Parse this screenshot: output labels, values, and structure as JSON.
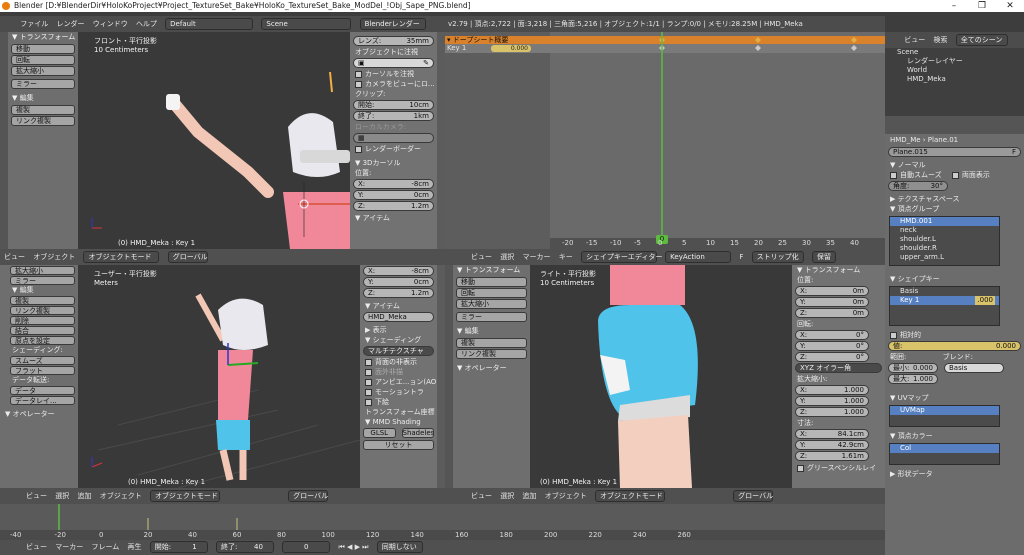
{
  "titlebar": {
    "title": "Blender [D:¥BlenderDir¥HoloKoProject¥Project_TextureSet_Bake¥HoloKo_TextureSet_Bake_ModDel_!Obj_Sape_PNG.blend]"
  },
  "infobar": {
    "menus": [
      "ファイル",
      "レンダー",
      "ウィンドウ",
      "ヘルプ"
    ],
    "layout": "Default",
    "scene": "Scene",
    "engine": "Blenderレンダー",
    "stats": "v2.79 | 頂点:2,722 | 面:3,218 | 三角面:5,216 | オブジェクト:1/1 | ランプ:0/0 | メモリ:28.25M | HMD_Meka"
  },
  "toolshelf_top": {
    "section1": "▼ トランスフォーム",
    "buttons1": [
      "移動",
      "回転",
      "拡大縮小",
      "ミラー"
    ],
    "section2": "▼ 編集",
    "buttons2": [
      "複製",
      "リンク複製"
    ],
    "tabs": [
      "ツール",
      "作成",
      "リレーション",
      "アニメーション",
      "物理演算",
      "グリース",
      "MMD"
    ]
  },
  "viewport_top": {
    "view": "フロント・平行投影",
    "scale": "10 Centimeters",
    "object": "(0) HMD_Meka : Key 1"
  },
  "npanel_top": {
    "lens_label": "レンズ:",
    "lens_value": "35mm",
    "lock_label": "オブジェクトに注視",
    "lock_cursor": "カーソルを注視",
    "lock_camera": "カメラをビューにロ...",
    "clip_label": "クリップ:",
    "clip_start_label": "開始:",
    "clip_start": "10cm",
    "clip_end_label": "終了:",
    "clip_end": "1km",
    "local_camera": "ローカルカメラ:",
    "render_border": "レンダーボーダー",
    "cursor_section": "▼ 3Dカーソル",
    "location_label": "位置:",
    "x_label": "X:",
    "x": "-8cm",
    "y_label": "Y:",
    "y": "0cm",
    "z_label": "Z:",
    "z": "1.2m",
    "item_section": "▼ アイテム"
  },
  "dopesheet": {
    "summary": "ドープシート概要",
    "key_label": "Key 1",
    "key_value": "0.000",
    "ruler": [
      "-20",
      "-15",
      "-10",
      "-5",
      "0",
      "5",
      "10",
      "15",
      "20",
      "25",
      "30",
      "35",
      "40"
    ],
    "current_frame": "0",
    "header": [
      "ビュー",
      "選択",
      "マーカー",
      "キー"
    ],
    "mode": "シェイプキーエディター",
    "action": "KeyAction",
    "action_flag": "F",
    "stash": "ストリップ化",
    "push": "保留"
  },
  "outliner": {
    "header_view": "ビュー",
    "header_search": "検索",
    "filter": "全てのシーン",
    "items": [
      "Scene",
      "レンダーレイヤー",
      "World",
      "HMD_Meka"
    ]
  },
  "properties": {
    "breadcrumb_obj": "HMD_Me",
    "breadcrumb_mesh": "Plane.01",
    "mesh_name": "Plane.015",
    "mesh_flag": "F",
    "normals_section": "▼ ノーマル",
    "auto_smooth": "自動スムーズ",
    "double_sided": "両面表示",
    "angle_label": "角度:",
    "angle": "30°",
    "texspace_section": "▶ テクスチャスペース",
    "vgroups_section": "▼ 頂点グループ",
    "vgroups": [
      "HMD.001",
      "neck",
      "shoulder.L",
      "shoulder.R",
      "upper_arm.L"
    ],
    "shapekeys_section": "▼ シェイプキー",
    "shapekeys": [
      {
        "name": "Basis",
        "value": ""
      },
      {
        "name": "Key 1",
        "value": ".000"
      }
    ],
    "relative": "相対的",
    "value_label": "値:",
    "value": "0.000",
    "range_label": "範囲:",
    "blend_label": "ブレンド:",
    "min_label": "最小:",
    "min": "0.000",
    "max_label": "最大:",
    "max": "1.000",
    "blend_target": "Basis",
    "uv_section": "▼ UVマップ",
    "uvmap": "UVMap",
    "vcol_section": "▼ 頂点カラー",
    "vcol": "Col",
    "shape_data": "▶ 形状データ"
  },
  "viewport_bar_mid": {
    "menus": [
      "ビュー",
      "選択",
      "追加",
      "オブジェクト"
    ],
    "mode": "オブジェクトモード",
    "orient": "グローバル"
  },
  "toolshelf_bottom": {
    "items": [
      "拡大縮小",
      "ミラー",
      "▼ 編集",
      "複製",
      "リンク複製",
      "削除",
      "結合",
      "原点を設定",
      "シェーディング:",
      "スムーズ",
      "フラット",
      "データ転送:",
      "データ",
      "データレイ..."
    ],
    "operator": "▼ オペレーター"
  },
  "viewport_bl": {
    "view": "ユーザー・平行投影",
    "scale": "Meters",
    "object": "(0) HMD_Meka : Key 1"
  },
  "npanel_bottom": {
    "x_label": "X:",
    "x": "-8cm",
    "y_label": "Y:",
    "y": "0cm",
    "z_label": "Z:",
    "z": "1.2m",
    "item_section": "▼ アイテム",
    "item_name": "HMD_Meka",
    "display_section": "▶ 表示",
    "shading_section": "▼ シェーディング",
    "shading_mode": "マルチテクスチャ",
    "backface": "背面の非表示",
    "matcap": "面外非描",
    "ao": "アンビエ...ョン(AO)",
    "motion_tracking": "モーショントラ",
    "background": "下絵",
    "transform_orient": "トランスフォーム座標",
    "mmd_section": "▼ MMD Shading",
    "glsl": "GLSL",
    "shadeless": "Shadeless",
    "reset": "リセット"
  },
  "toolshelf_br": {
    "section1": "▼ トランスフォーム",
    "buttons1": [
      "移動",
      "回転",
      "拡大縮小",
      "ミラー"
    ],
    "section2": "▼ 編集",
    "buttons2": [
      "複製",
      "リンク複製"
    ],
    "operator": "▼ オペレーター"
  },
  "viewport_br": {
    "view": "ライト・平行投影",
    "scale": "10 Centimeters",
    "object": "(0) HMD_Meka : Key 1"
  },
  "transform_panel": {
    "title": "▼ トランスフォーム",
    "location_label": "位置:",
    "loc": [
      {
        "l": "X:",
        "v": "0m"
      },
      {
        "l": "Y:",
        "v": "0m"
      },
      {
        "l": "Z:",
        "v": "0m"
      }
    ],
    "rotation_label": "回転:",
    "rot": [
      {
        "l": "X:",
        "v": "0°"
      },
      {
        "l": "Y:",
        "v": "0°"
      },
      {
        "l": "Z:",
        "v": "0°"
      }
    ],
    "rot_mode": "XYZ オイラー角",
    "scale_label": "拡大縮小:",
    "scl": [
      {
        "l": "X:",
        "v": "1.000"
      },
      {
        "l": "Y:",
        "v": "1.000"
      },
      {
        "l": "Z:",
        "v": "1.000"
      }
    ],
    "dim_label": "寸法:",
    "dim": [
      {
        "l": "X:",
        "v": "84.1cm"
      },
      {
        "l": "Y:",
        "v": "42.9cm"
      },
      {
        "l": "Z:",
        "v": "1.61m"
      }
    ],
    "grease": "グリースペンシルレイ"
  },
  "viewport_bar_bottom": {
    "menus": [
      "ビュー",
      "選択",
      "追加",
      "オブジェクト"
    ],
    "mode": "オブジェクトモード",
    "orient": "グローバル",
    "menus2": [
      "ビュー",
      "選択",
      "追加",
      "オブジェクト"
    ],
    "mode2": "オブジェクトモード",
    "orient2": "グローバル"
  },
  "timeline": {
    "ruler": [
      "-40",
      "-20",
      "0",
      "20",
      "40",
      "60",
      "80",
      "100",
      "120",
      "140",
      "160",
      "180",
      "200",
      "220",
      "240",
      "260"
    ],
    "footer_menus": [
      "ビュー",
      "マーカー",
      "フレーム",
      "再生"
    ],
    "start_label": "開始:",
    "start": "1",
    "end_label": "終了:",
    "end": "40",
    "frame": "0",
    "sync": "同期しない"
  },
  "colors": {
    "accent": "#5680c2",
    "dopesheet_summary": "#d9822b",
    "frame_line": "#5dbb3f"
  }
}
